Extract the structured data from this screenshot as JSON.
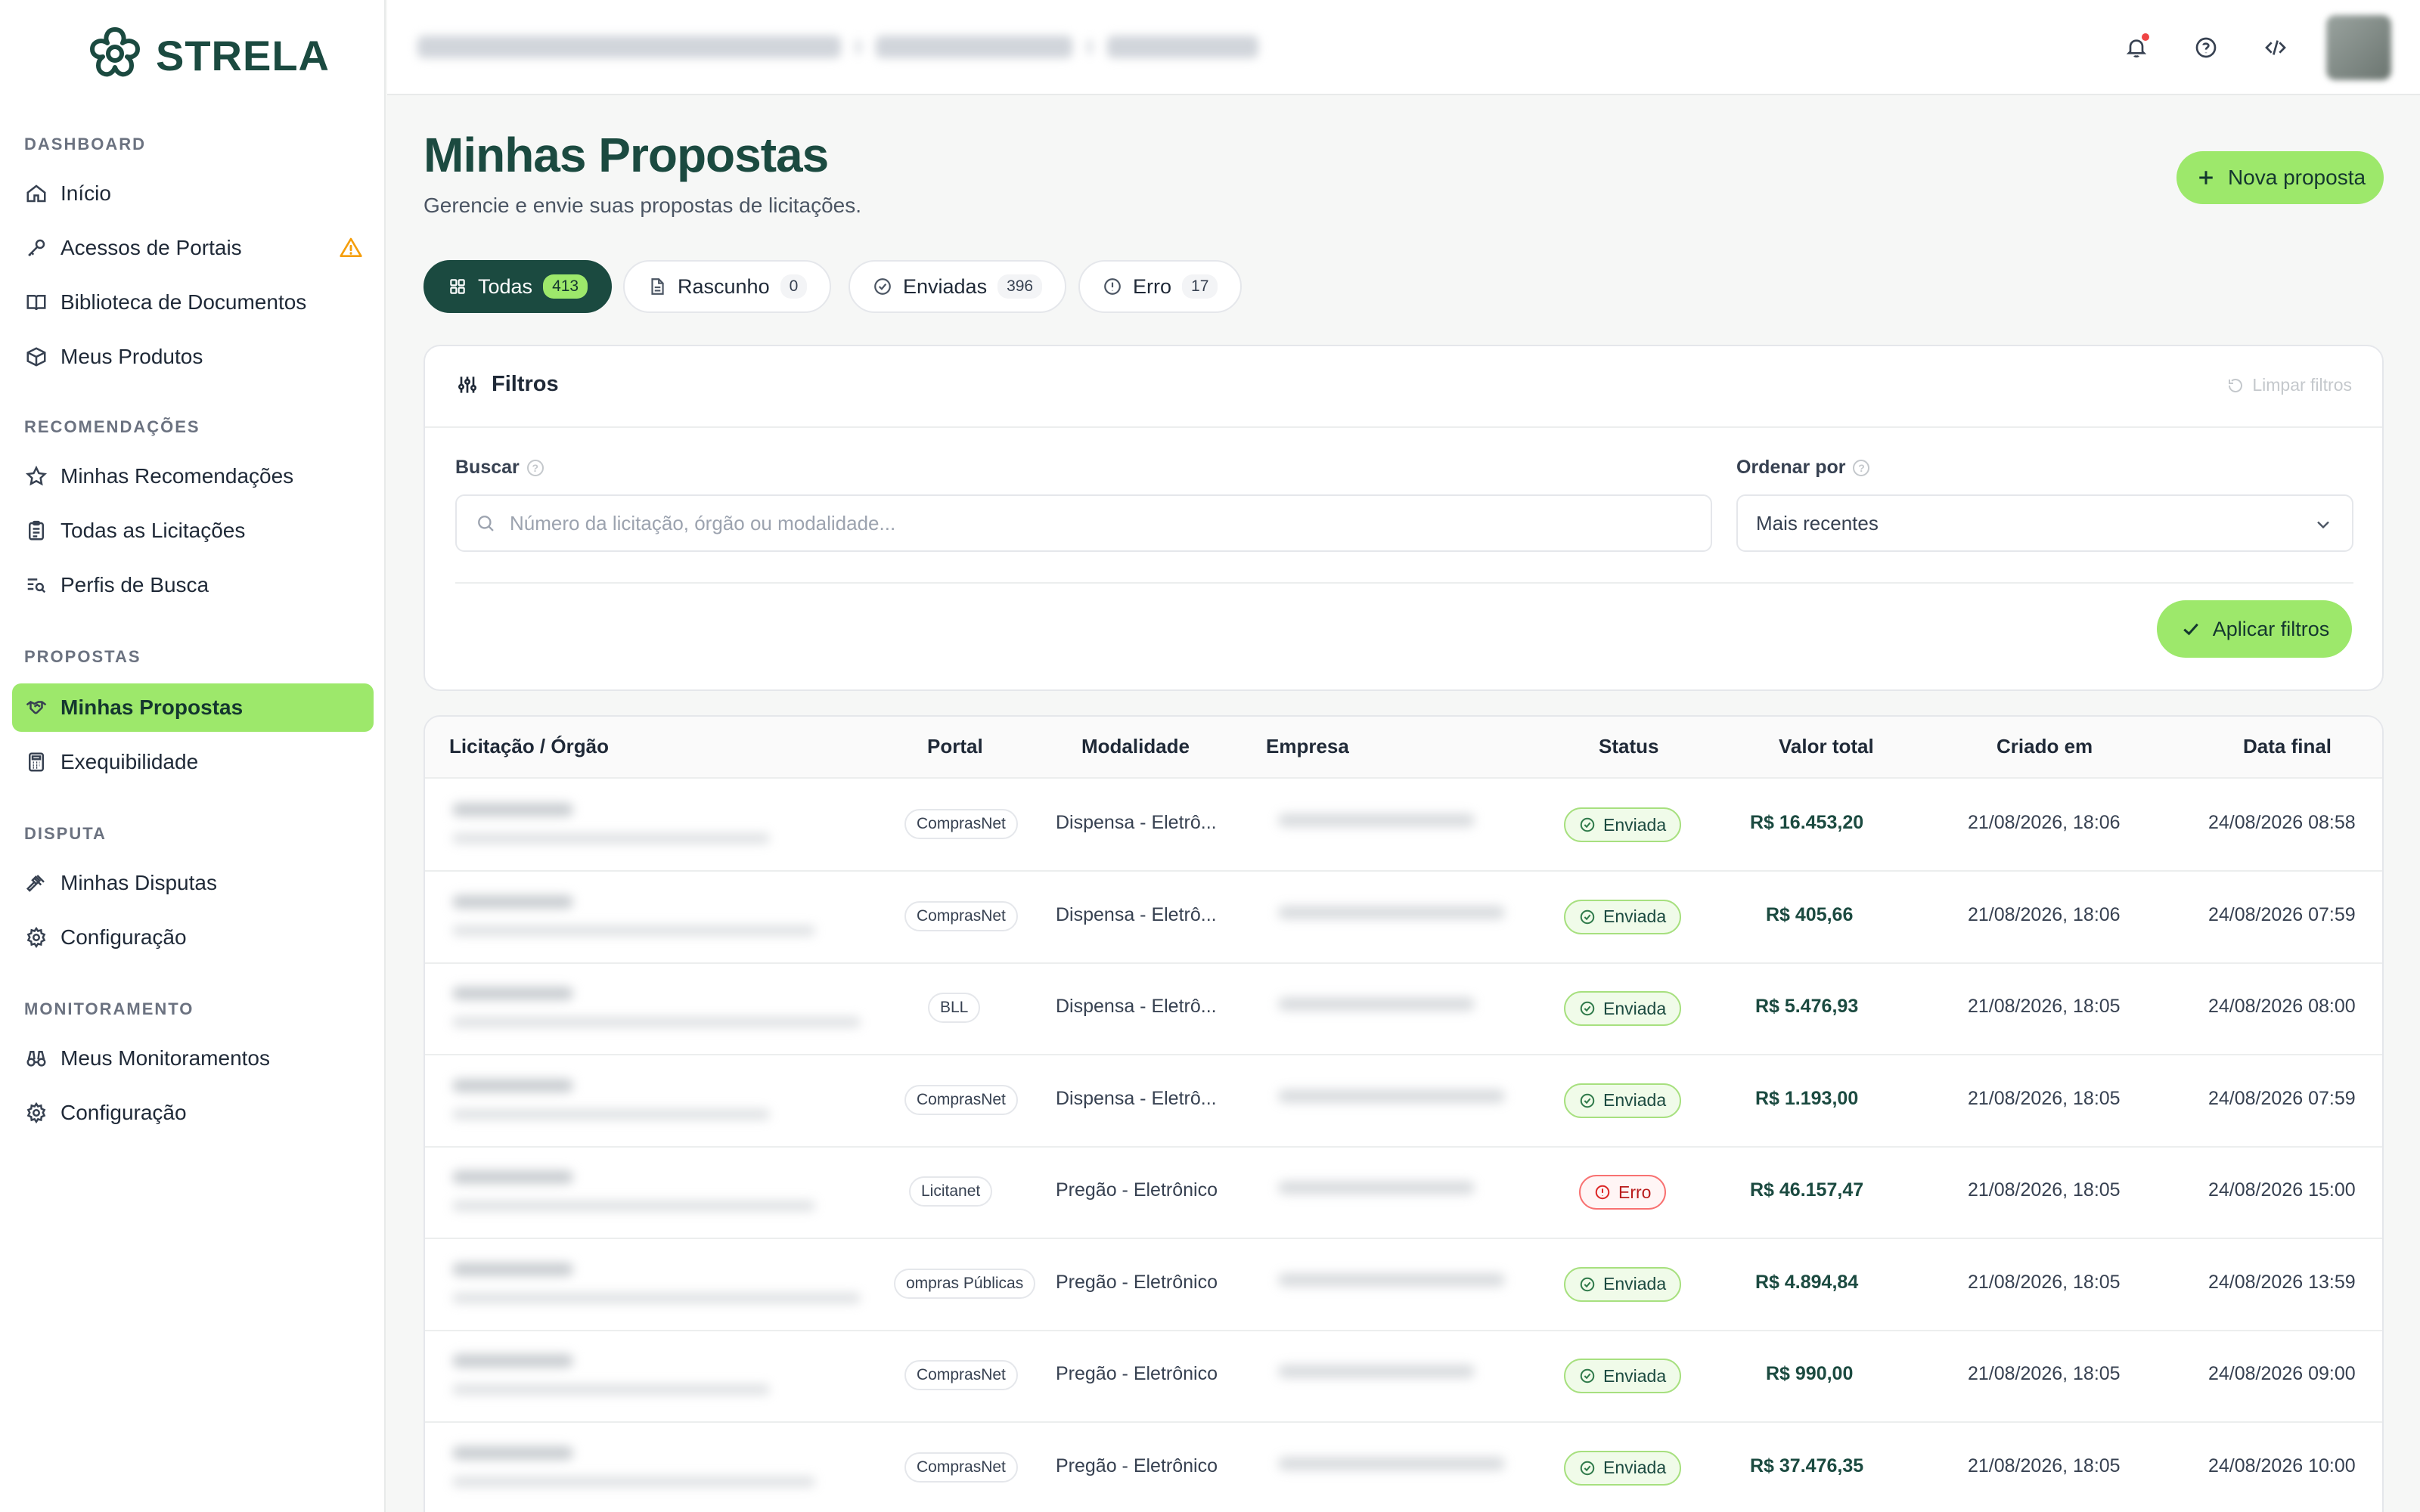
{
  "brand": {
    "name": "STRELA"
  },
  "sidebar": {
    "sections": [
      {
        "title": "DASHBOARD",
        "items": [
          {
            "label": "Início",
            "icon": "home-icon"
          },
          {
            "label": "Acessos de Portais",
            "icon": "key-icon",
            "warning": true
          },
          {
            "label": "Biblioteca de Documentos",
            "icon": "book-icon"
          },
          {
            "label": "Meus Produtos",
            "icon": "box-icon"
          }
        ]
      },
      {
        "title": "RECOMENDAÇÕES",
        "items": [
          {
            "label": "Minhas Recomendações",
            "icon": "star-icon"
          },
          {
            "label": "Todas as Licitações",
            "icon": "clipboard-icon"
          },
          {
            "label": "Perfis de Busca",
            "icon": "list-search-icon"
          }
        ]
      },
      {
        "title": "PROPOSTAS",
        "items": [
          {
            "label": "Minhas Propostas",
            "icon": "handshake-icon",
            "active": true
          },
          {
            "label": "Exequibilidade",
            "icon": "calculator-icon"
          }
        ]
      },
      {
        "title": "DISPUTA",
        "items": [
          {
            "label": "Minhas Disputas",
            "icon": "gavel-icon"
          },
          {
            "label": "Configuração",
            "icon": "gear-icon"
          }
        ]
      },
      {
        "title": "MONITORAMENTO",
        "items": [
          {
            "label": "Meus Monitoramentos",
            "icon": "binoculars-icon"
          },
          {
            "label": "Configuração",
            "icon": "gear-icon"
          }
        ]
      }
    ]
  },
  "header": {
    "title": "Minhas Propostas",
    "subtitle": "Gerencie e envie suas propostas de licitações.",
    "new_button": "Nova proposta"
  },
  "tabs": [
    {
      "label": "Todas",
      "count": "413",
      "active": true,
      "icon": "grid-icon"
    },
    {
      "label": "Rascunho",
      "count": "0",
      "icon": "file-icon"
    },
    {
      "label": "Enviadas",
      "count": "396",
      "icon": "check-circle-icon"
    },
    {
      "label": "Erro",
      "count": "17",
      "icon": "alert-circle-icon"
    }
  ],
  "filters": {
    "title": "Filtros",
    "clear_label": "Limpar filtros",
    "search_label": "Buscar",
    "search_placeholder": "Número da licitação, órgão ou modalidade...",
    "order_label": "Ordenar por",
    "order_value": "Mais recentes",
    "apply_label": "Aplicar filtros"
  },
  "table": {
    "columns": [
      "Licitação / Órgão",
      "Portal",
      "Modalidade",
      "Empresa",
      "Status",
      "Valor total",
      "Criado em",
      "Data final"
    ],
    "rows": [
      {
        "portal": "ComprasNet",
        "modalidade": "Dispensa - Eletrô...",
        "status": "Enviada",
        "status_type": "ok",
        "valor": "R$ 16.453,20",
        "criado": "21/08/2026, 18:06",
        "final": "24/08/2026 08:58"
      },
      {
        "portal": "ComprasNet",
        "modalidade": "Dispensa - Eletrô...",
        "status": "Enviada",
        "status_type": "ok",
        "valor": "R$ 405,66",
        "criado": "21/08/2026, 18:06",
        "final": "24/08/2026 07:59"
      },
      {
        "portal": "BLL",
        "modalidade": "Dispensa - Eletrô...",
        "status": "Enviada",
        "status_type": "ok",
        "valor": "R$ 5.476,93",
        "criado": "21/08/2026, 18:05",
        "final": "24/08/2026 08:00"
      },
      {
        "portal": "ComprasNet",
        "modalidade": "Dispensa - Eletrô...",
        "status": "Enviada",
        "status_type": "ok",
        "valor": "R$ 1.193,00",
        "criado": "21/08/2026, 18:05",
        "final": "24/08/2026 07:59"
      },
      {
        "portal": "Licitanet",
        "modalidade": "Pregão - Eletrônico",
        "status": "Erro",
        "status_type": "err",
        "valor": "R$ 46.157,47",
        "criado": "21/08/2026, 18:05",
        "final": "24/08/2026 15:00"
      },
      {
        "portal": "ompras Públicas",
        "modalidade": "Pregão - Eletrônico",
        "status": "Enviada",
        "status_type": "ok",
        "valor": "R$ 4.894,84",
        "criado": "21/08/2026, 18:05",
        "final": "24/08/2026 13:59"
      },
      {
        "portal": "ComprasNet",
        "modalidade": "Pregão - Eletrônico",
        "status": "Enviada",
        "status_type": "ok",
        "valor": "R$ 990,00",
        "criado": "21/08/2026, 18:05",
        "final": "24/08/2026 09:00"
      },
      {
        "portal": "ComprasNet",
        "modalidade": "Pregão - Eletrônico",
        "status": "Enviada",
        "status_type": "ok",
        "valor": "R$ 37.476,35",
        "criado": "21/08/2026, 18:05",
        "final": "24/08/2026 10:00"
      }
    ]
  },
  "colors": {
    "accent": "#9de86b",
    "brand": "#1b4a40",
    "error": "#dc2626"
  }
}
